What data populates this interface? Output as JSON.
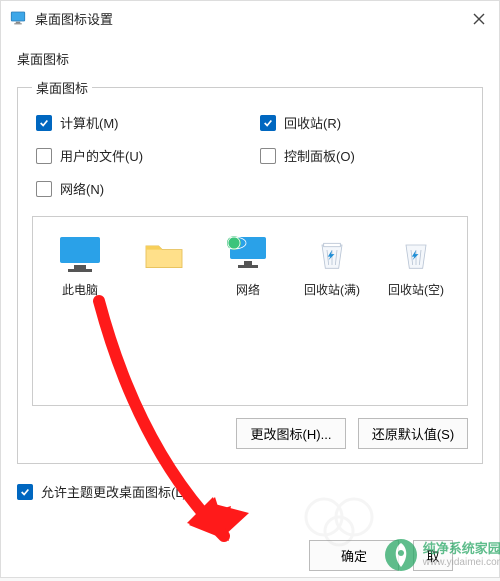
{
  "window": {
    "title": "桌面图标设置"
  },
  "section_label": "桌面图标",
  "group_legend": "桌面图标",
  "checkboxes": {
    "computer": {
      "label": "计算机(M)",
      "checked": true
    },
    "recycle": {
      "label": "回收站(R)",
      "checked": true
    },
    "userfiles": {
      "label": "用户的文件(U)",
      "checked": false
    },
    "control": {
      "label": "控制面板(O)",
      "checked": false
    },
    "network": {
      "label": "网络(N)",
      "checked": false
    }
  },
  "preview": {
    "items": [
      {
        "label": "此电脑"
      },
      {
        "label": ""
      },
      {
        "label": "网络"
      },
      {
        "label": "回收站(满)"
      },
      {
        "label": "回收站(空)"
      }
    ]
  },
  "buttons": {
    "change_icon": "更改图标(H)...",
    "restore_default": "还原默认值(S)",
    "ok": "确定",
    "cancel": "取"
  },
  "allow_theme": {
    "label": "允许主题更改桌面图标(L)",
    "checked": true
  },
  "watermark": {
    "cn": "纯净系统家园",
    "url": "www.yidaimei.com"
  }
}
